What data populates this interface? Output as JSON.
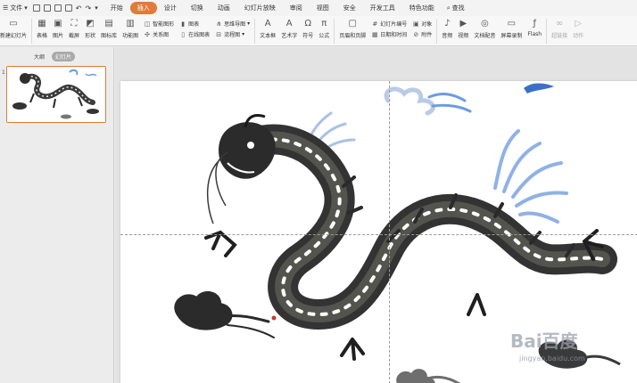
{
  "menubar": {
    "file_label": "文件",
    "tabs": [
      "开始",
      "插入",
      "设计",
      "切换",
      "动画",
      "幻灯片放映",
      "审阅",
      "视图",
      "安全",
      "开发工具",
      "特色功能"
    ],
    "active_tab": "插入",
    "search_label": "查找"
  },
  "ribbon": {
    "new_slide": "新建幻灯片",
    "table": "表格",
    "picture": "图片",
    "screenshot": "截屏",
    "shape": "形状",
    "icon_lib": "图标库",
    "func_chart": "功能图",
    "smart_shape": "智能图形",
    "chart": "图表",
    "relation": "关系图",
    "online_chart": "在线图表",
    "mindmap": "思维导图",
    "flowchart": "流程图",
    "textbox": "文本框",
    "wordart": "艺术字",
    "symbol": "符号",
    "formula": "公式",
    "header_footer": "页眉和页脚",
    "slide_number": "幻灯片编号",
    "object": "对象",
    "datetime": "日期和时间",
    "attachment": "附件",
    "audio": "音频",
    "video": "视频",
    "text_dub": "文档配音",
    "screen_rec": "屏幕录制",
    "flash": "Flash",
    "hyperlink": "超链接",
    "action": "动作"
  },
  "panel": {
    "tab_outline": "大纲",
    "tab_slides": "幻灯片",
    "slide_number": "1"
  },
  "watermark": {
    "main": "Bai百度",
    "sub": "jingyan.baidu.com"
  },
  "colors": {
    "accent": "#e07b39",
    "cloud_blue": "#5b8ed8"
  },
  "icons": [
    "menu-icon",
    "save-icon",
    "print-icon",
    "undo-icon",
    "redo-icon",
    "search-icon",
    "table-icon",
    "picture-icon",
    "shape-icon",
    "textbox-icon",
    "symbol-icon",
    "formula-icon",
    "audio-icon",
    "video-icon",
    "flash-icon",
    "hyperlink-icon"
  ]
}
